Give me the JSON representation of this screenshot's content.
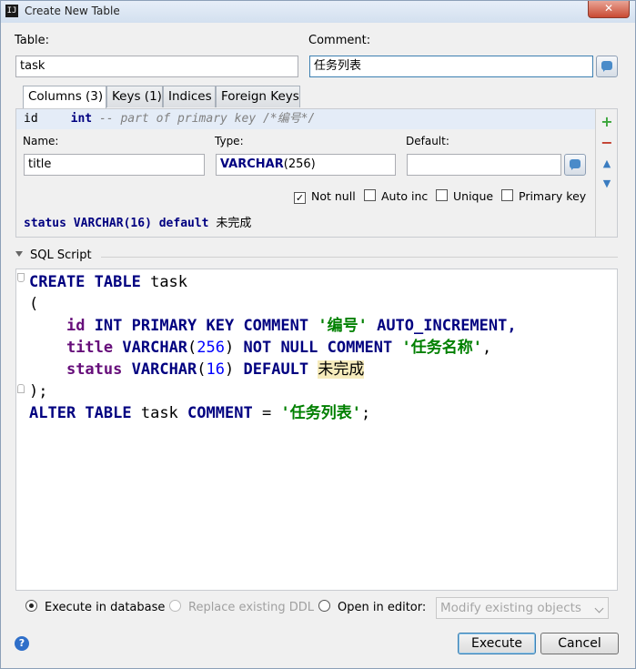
{
  "window": {
    "title": "Create New Table",
    "app_icon": "IJ",
    "close_glyph": "✕"
  },
  "table_label": "Table:",
  "table_value": "task",
  "comment_label": "Comment:",
  "comment_value": "任务列表",
  "tabs": [
    {
      "label": "Columns (3)",
      "active": true
    },
    {
      "label": "Keys (1)",
      "active": false
    },
    {
      "label": "Indices",
      "active": false
    },
    {
      "label": "Foreign Keys",
      "active": false
    }
  ],
  "columns_panel": {
    "summary": {
      "name": "id",
      "type": "int",
      "comment": "-- part of primary key /*编号*/"
    },
    "name_label": "Name:",
    "name_value": "title",
    "type_label": "Type:",
    "type_keyword": "VARCHAR",
    "type_args": "(256)",
    "default_label": "Default:",
    "default_value": "",
    "checkboxes": [
      {
        "label": "Not null",
        "checked": true
      },
      {
        "label": "Auto inc",
        "checked": false
      },
      {
        "label": "Unique",
        "checked": false
      },
      {
        "label": "Primary key",
        "checked": false
      }
    ],
    "status_row": {
      "name": "status",
      "type": "VARCHAR(16)",
      "kw": "default",
      "value": "未完成"
    },
    "tools": {
      "add": "+",
      "remove": "−",
      "up": "▲",
      "down": "▼"
    }
  },
  "sql_section_label": "SQL Script",
  "sql_lines": {
    "l1_kw": "CREATE TABLE",
    "l1_name": "task",
    "l2": "(",
    "l3_field": "id",
    "l3_kw": "INT PRIMARY KEY COMMENT",
    "l3_str": "'编号'",
    "l3_tail": "AUTO_INCREMENT,",
    "l4_field": "title",
    "l4_kw": "VARCHAR",
    "l4_num": "256",
    "l4_kw2": "NOT NULL COMMENT",
    "l4_str": "'任务名称'",
    "l4_tail": ",",
    "l5_field": "status",
    "l5_kw": "VARCHAR",
    "l5_num": "16",
    "l5_kw2": "DEFAULT",
    "l5_err": "未完成",
    "l6": ");",
    "l7_kw": "ALTER TABLE",
    "l7_name": "task",
    "l7_kw2": "COMMENT",
    "l7_eq": "=",
    "l7_str": "'任务列表'",
    "l7_tail": ";"
  },
  "options": {
    "execute_in_db": "Execute in database",
    "replace_ddl": "Replace existing DDL",
    "open_in_editor": "Open in editor:",
    "modify_select": "Modify existing objects"
  },
  "buttons": {
    "help": "?",
    "execute": "Execute",
    "cancel": "Cancel"
  },
  "colors": {
    "accent": "#3c7fb1",
    "keyword": "#000080",
    "string": "#008000",
    "field": "#660e7a",
    "error_bg": "#f6ebbc",
    "add": "#3aa53a",
    "remove": "#c23a2a",
    "arrow": "#3a7cc0"
  }
}
